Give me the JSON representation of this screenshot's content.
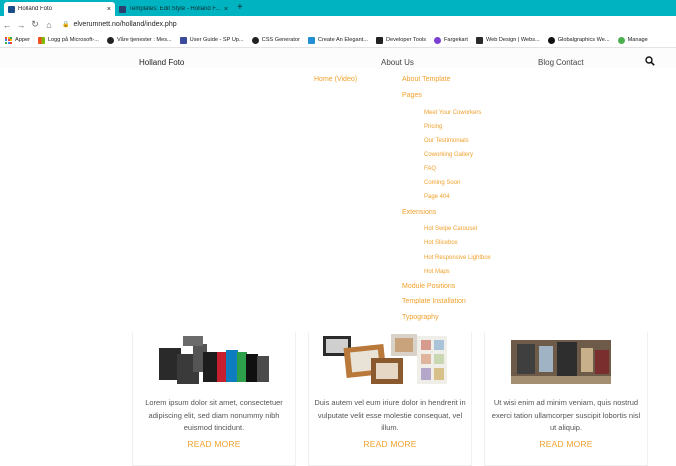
{
  "browser": {
    "tabs": [
      {
        "title": "Holland Foto",
        "favicon_color": "#1a4f8a"
      },
      {
        "title": "Templates: Edit Style - Holland F...",
        "favicon_color": "#2b3e6f"
      }
    ],
    "new_tab_symbol": "+",
    "close_symbol": "×",
    "address": "elverumnett.no/holland/index.php",
    "bookmarks": [
      {
        "label": "Apper",
        "icon": "apps-grid-icon",
        "color": "#ea4335"
      },
      {
        "label": "Logg på Microsoft-...",
        "icon": "microsoft-icon",
        "color": "#f25022"
      },
      {
        "label": "Våre tjenester : Mes...",
        "icon": "globe-icon",
        "color": "#222222"
      },
      {
        "label": "User Guide - SP Up...",
        "icon": "k-icon",
        "color": "#3b4a9b"
      },
      {
        "label": "CSS Generator",
        "icon": "globe-icon",
        "color": "#222222"
      },
      {
        "label": "Create An Elegant...",
        "icon": "x-icon",
        "color": "#1f8fd6"
      },
      {
        "label": "Developer Tools",
        "icon": "code-icon",
        "color": "#222222"
      },
      {
        "label": "Fargekart",
        "icon": "palette-icon",
        "color": "#7b3fd1"
      },
      {
        "label": "Web Design | Webs...",
        "icon": "pen-icon",
        "color": "#2a2a2a"
      },
      {
        "label": "Globalgraphics We...",
        "icon": "chat-icon",
        "color": "#111111"
      },
      {
        "label": "Manage",
        "icon": "circle-icon",
        "color": "#4caf50"
      }
    ]
  },
  "site": {
    "brand": "Holland Foto",
    "nav": {
      "about": "About Us",
      "blog": "Blog",
      "contact": "Contact"
    },
    "menu": {
      "home_video": "Home (Video)",
      "about_template": "About Template",
      "pages": "Pages",
      "pages_items": [
        "Meet Your Coworkers",
        "Pricing",
        "Our Testimonials",
        "Coworking Gallery",
        "FAQ",
        "Coming Soon",
        "Page 404"
      ],
      "extensions": "Extensions",
      "extensions_items": [
        "Hot Swipe Carousel",
        "Hot Slicebox",
        "Hot Responsive Lightbox",
        "Hot Maps"
      ],
      "module_positions": "Module Positions",
      "template_installation": "Template Installation",
      "typography": "Typography"
    },
    "cards": [
      {
        "text": "Lorem ipsum dolor sit amet, consectetuer adipiscing elit, sed diam nonummy nibh euismod tincidunt.",
        "more": "READ MORE"
      },
      {
        "text": "Duis autem vel eum iriure dolor in hendrerit in vulputate velit esse molestie consequat, vel illum.",
        "more": "READ MORE"
      },
      {
        "text": "Ut wisi enim ad minim veniam, quis nostrud exerci tation ullamcorper suscipit lobortis nisl ut aliquip.",
        "more": "READ MORE"
      }
    ]
  },
  "colors": {
    "accent": "#f0a12c",
    "chrome": "#00b3c1"
  }
}
